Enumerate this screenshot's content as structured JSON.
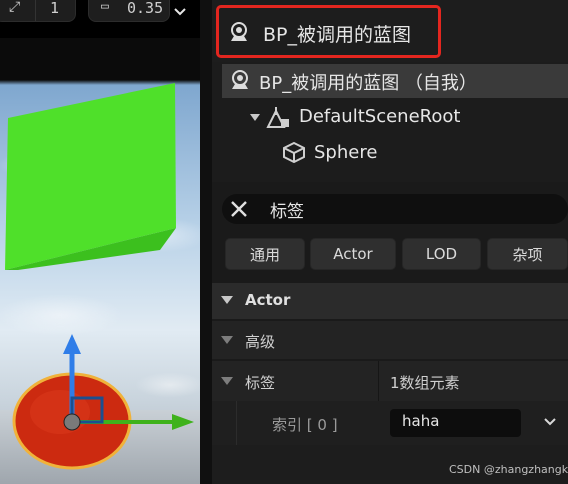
{
  "viewport": {
    "topbar": {
      "button_left": "1",
      "button_right": "0.35"
    },
    "colors": {
      "cube": "#4fe02a",
      "sphere": "#cc2a10",
      "gizmo_up": "#2f7de8",
      "gizmo_right": "#3fb21c"
    }
  },
  "blueprint": {
    "title": "BP_被调用的蓝图",
    "highlight_color": "#e3261f"
  },
  "components": {
    "self_label": "BP_被调用的蓝图 （自我）",
    "root_label": "DefaultSceneRoot",
    "child_label": "Sphere"
  },
  "search": {
    "query": "标签"
  },
  "filter_tabs": [
    "通用",
    "Actor",
    "LOD",
    "杂项"
  ],
  "details": {
    "actor_section": "Actor",
    "advanced_section": "高级",
    "tags_label": "标签",
    "tags_value": "1数组元素",
    "index_label": "索引 [ 0 ]",
    "index_value": "haha"
  },
  "watermark": "CSDN @zhangzhangkeji"
}
